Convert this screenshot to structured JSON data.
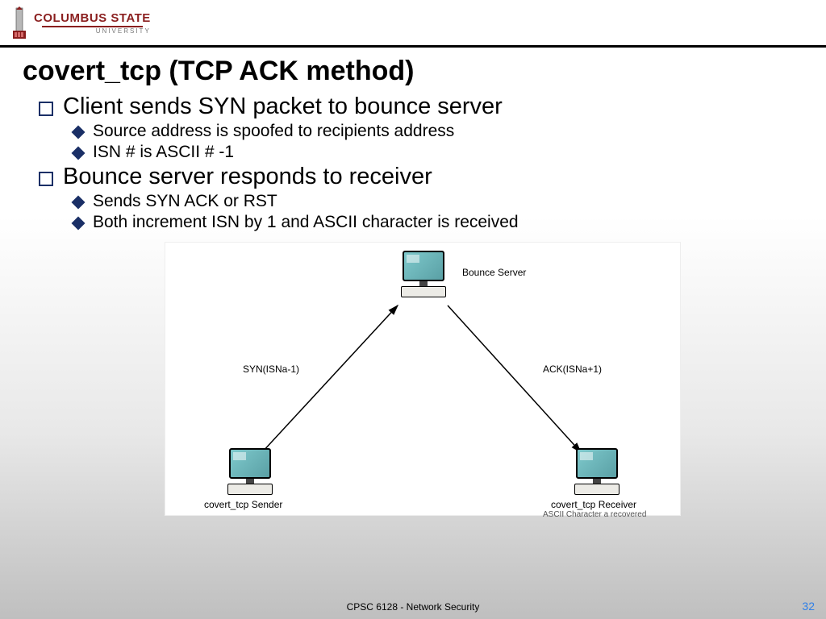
{
  "university": {
    "name_line1": "COLUMBUS STATE",
    "name_line2": "UNIVERSITY"
  },
  "slide": {
    "title": "covert_tcp (TCP ACK method)",
    "bullets": [
      {
        "text": "Client sends SYN packet to bounce server",
        "sub": [
          "Source address is spoofed to recipients address",
          "ISN # is ASCII # -1"
        ]
      },
      {
        "text": "Bounce server responds to receiver",
        "sub": [
          "Sends SYN ACK or RST",
          "Both increment ISN by 1 and ASCII character is received"
        ]
      }
    ]
  },
  "diagram": {
    "node_top": "Bounce Server",
    "node_left": "covert_tcp Sender",
    "node_right": "covert_tcp Receiver",
    "edge_left": "SYN(ISNa-1)",
    "edge_right": "ACK(ISNa+1)",
    "note_right": "ASCII Character a recovered"
  },
  "footer": {
    "course": "CPSC 6128 - Network Security",
    "page": "32"
  }
}
